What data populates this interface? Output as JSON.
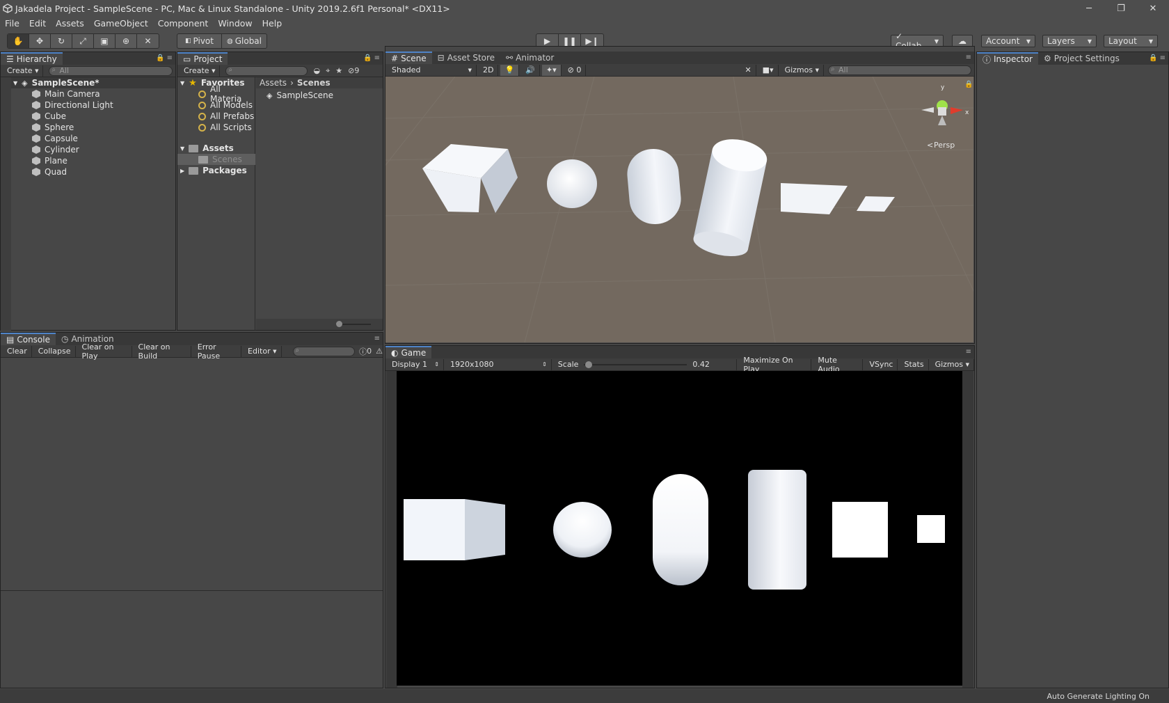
{
  "window": {
    "title": "Jakadela Project - SampleScene - PC, Mac & Linux Standalone - Unity 2019.2.6f1 Personal* <DX11>",
    "minimize": "─",
    "restore": "❐",
    "close": "✕"
  },
  "menu": [
    "File",
    "Edit",
    "Assets",
    "GameObject",
    "Component",
    "Window",
    "Help"
  ],
  "toolbar": {
    "pivot": "Pivot",
    "global": "Global",
    "collab": "Collab",
    "account": "Account",
    "layers": "Layers",
    "layout": "Layout"
  },
  "hierarchy": {
    "tab": "Hierarchy",
    "create": "Create",
    "search_placeholder": "All",
    "scene": "SampleScene*",
    "items": [
      "Main Camera",
      "Directional Light",
      "Cube",
      "Sphere",
      "Capsule",
      "Cylinder",
      "Plane",
      "Quad"
    ]
  },
  "project": {
    "tab": "Project",
    "create": "Create",
    "count": "9",
    "favorites": "Favorites",
    "fav_items": [
      "All Materia",
      "All Models",
      "All Prefabs",
      "All Scripts"
    ],
    "assets": "Assets",
    "scenes": "Scenes",
    "packages": "Packages",
    "breadcrumb_root": "Assets",
    "breadcrumb_sep": "›",
    "breadcrumb_current": "Scenes",
    "file": "SampleScene"
  },
  "scene": {
    "tabs": [
      "Scene",
      "Asset Store",
      "Animator"
    ],
    "shading": "Shaded",
    "mode2d": "2D",
    "hidden_count": "0",
    "gizmos": "Gizmos",
    "search_placeholder": "All",
    "persp": "Persp",
    "axis_y": "y",
    "axis_x": "x"
  },
  "inspector": {
    "tabs": [
      "Inspector",
      "Project Settings"
    ]
  },
  "console": {
    "tabs": [
      "Console",
      "Animation"
    ],
    "buttons": [
      "Clear",
      "Collapse",
      "Clear on Play",
      "Clear on Build",
      "Error Pause",
      "Editor"
    ],
    "count": "0"
  },
  "game": {
    "tab": "Game",
    "display": "Display 1",
    "resolution": "1920x1080",
    "scale_label": "Scale",
    "scale_value": "0.42",
    "scale_fraction": 0.01,
    "buttons": [
      "Maximize On Play",
      "Mute Audio",
      "VSync",
      "Stats",
      "Gizmos"
    ]
  },
  "status": {
    "text": "Auto Generate Lighting On"
  }
}
